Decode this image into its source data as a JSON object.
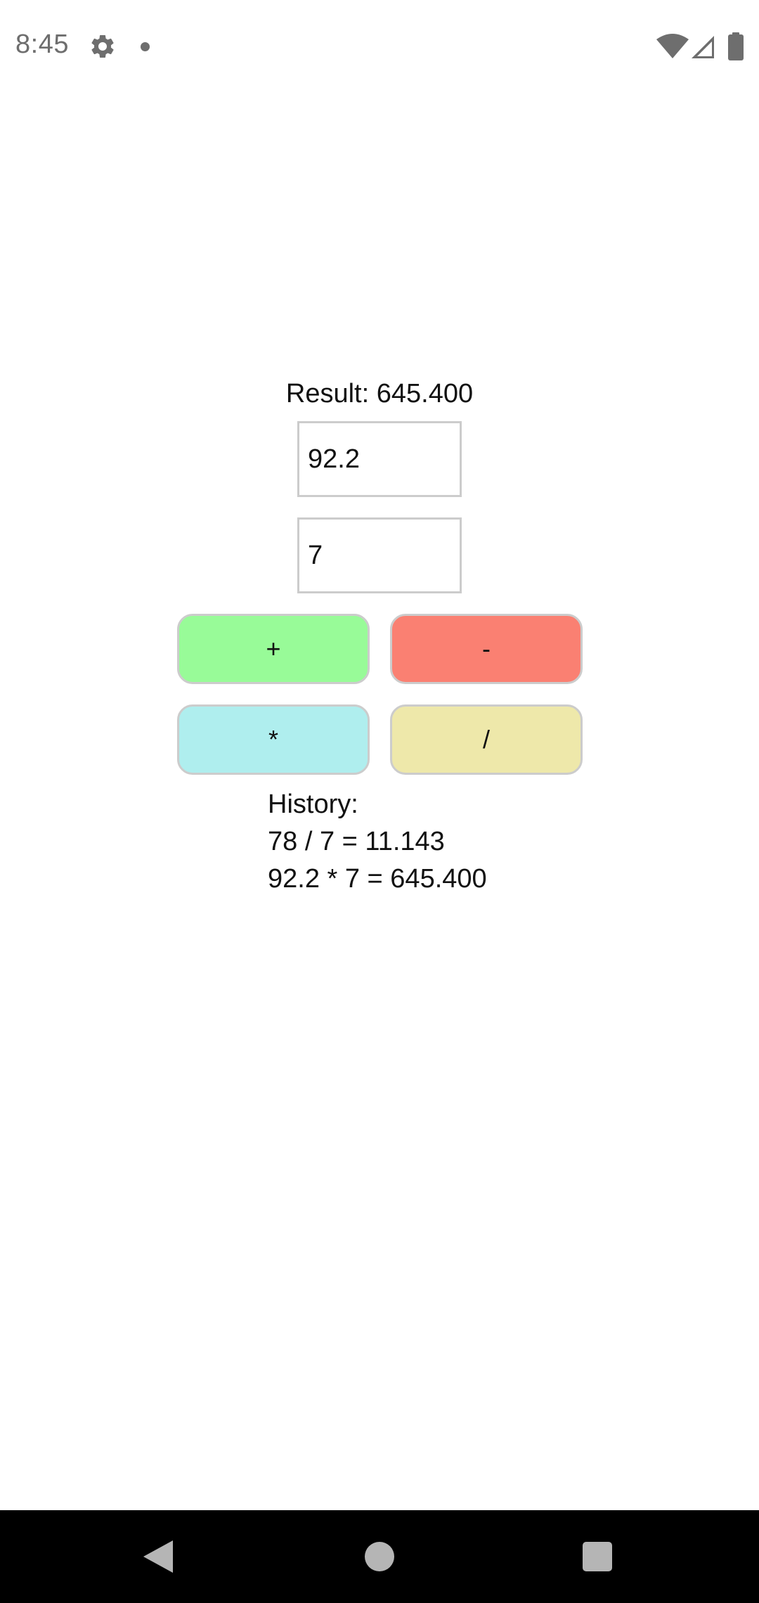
{
  "status_bar": {
    "time": "8:45",
    "icons": [
      "gear-icon",
      "notification-dot-icon",
      "wifi-icon",
      "cell-signal-icon",
      "battery-icon"
    ]
  },
  "calculator": {
    "result_text": "Result: 645.400",
    "first_number": "92.2",
    "second_number": "7",
    "buttons": {
      "add": "+",
      "subtract": "-",
      "multiply": "*",
      "divide": "/"
    },
    "button_colors": {
      "add": "#98fb98",
      "subtract": "#fa8072",
      "multiply": "#afeeee",
      "divide": "#eee8aa"
    }
  },
  "history": {
    "title": "History:",
    "entries": [
      "78 / 7 = 11.143",
      "92.2 * 7 = 645.400"
    ]
  },
  "nav_bar": {
    "icons": [
      "back-icon",
      "home-icon",
      "recents-icon"
    ]
  }
}
